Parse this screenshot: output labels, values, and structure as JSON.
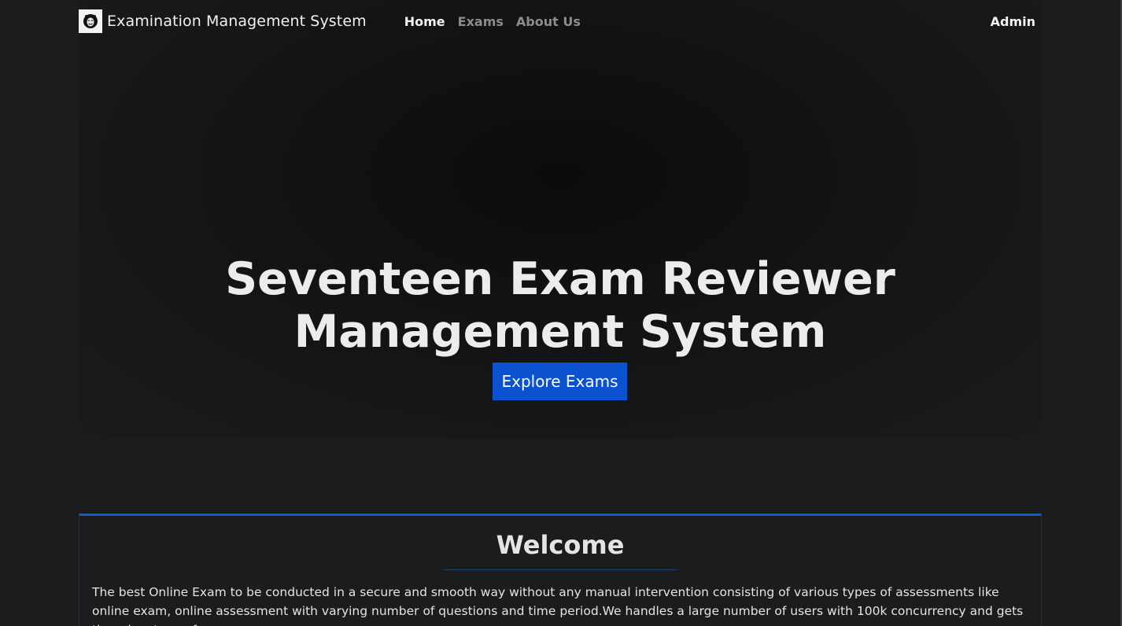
{
  "navbar": {
    "brand_icon": "hacker-mask-icon",
    "brand_name": "Examination Management System",
    "links": [
      {
        "label": "Home",
        "active": true
      },
      {
        "label": "Exams",
        "active": false
      },
      {
        "label": "About Us",
        "active": false
      }
    ],
    "user_label": "Admin"
  },
  "hero": {
    "title": "Seventeen Exam Reviewer Management System",
    "cta_label": "Explore Exams"
  },
  "welcome": {
    "title": "Welcome",
    "text": "The best Online Exam to be conducted in a secure and smooth way without any manual intervention consisting of various types of assessments like online exam, online assessment with varying number of questions and time period.We handles a large number of users with 100k concurrency and gets the advantage of a"
  },
  "colors": {
    "background": "#1b1c1e",
    "primary_button": "#0b52d0",
    "card_accent": "#0b5bd3"
  }
}
